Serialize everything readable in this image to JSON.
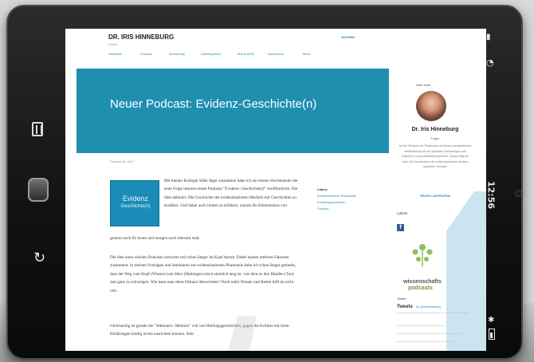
{
  "site": {
    "title": "DR. IRIS HINNEBURG",
    "subtitle": "Seiten",
    "search": "SUCHEN",
    "nav": [
      "Startseite",
      "Podcast",
      "Workshops",
      "Arbeitsproben",
      "Meine AGB",
      "Impressum",
      "Mehr…"
    ]
  },
  "post": {
    "title": "Neuer Podcast: Evidenz-Geschichte(n)",
    "date": "Februar 06, 2017",
    "thumbnail_line1": "Evidenz",
    "thumbnail_line2": "Geschichte(n)",
    "paragraph1a": "Mit meiner Kollegin Silke Jäger zusammen habe ich am letzten Wochenende die erste Folge unseres neuen Podcasts \"Evidenz- Geschichte(n)\" veröffentlicht. Die Idee dahinter: Die Geschichte der evidenzbasierten Medizin mit Geschichten zu erzählen. Und dabei auch immer zu erklären, warum die Erkenntnisse von",
    "paragraph1b": "gestern auch für heute und morgen noch relevant sind.",
    "paragraph2": "Die Idee eines solchen Podcasts schwirrte mir schon länger im Kopf herum. Dabei kamen mehrere Faktoren zusammen: In meinen Vorträgen und Seminaren zur evidenzbasierten Pharmazie habe ich schon länger gemerkt, dass der Weg vom Kopf (Wissen) zum Herz (Haltungen) doch ziemlich lang ist, von dem zu den Händen (Tun) mal ganz zu schweigen. Wie kann man diese Distanz überwinden? Noch mehr Wissen und Reden hilft da nicht viel.",
    "paragraph3": "Gleichzeitig ist gerade die \"Alternativ- Medizin\" voll von Heilungsgeschichten, gegen die Kritiker mit ihren Erklärungen häufig nichts ausrichten können. Sehr"
  },
  "labels": {
    "heading": "Labels",
    "items": [
      "Evidenzbasierte Pharmazie",
      "Evidenzgeschichten",
      "Podcast"
    ]
  },
  "sidebar": {
    "about_heading": "Über mich",
    "author": "Dr. Iris Hinneburg",
    "follow": "Folgen",
    "bio": "Ich bin Studium der Pharmazie und einer journalistischen Weiterbildung bin ich qualitativ hochwertigen und kritischen Gesundheitsinformationen. Darauf folgt ich mich mit Grundsätzen der evidenzbasierten Medizin angeführt. Kontakt:",
    "profile_link": "PROFIL AUFRUFEN",
    "labels_widget": "Labels",
    "facebook": "f",
    "logo_line1": "wissenschafts",
    "logo_line2": "podcasts",
    "twitter_heading": "Twitter",
    "tweets": "Tweets",
    "tweets_by": "by @irishinneburg"
  },
  "device": {
    "clock": "12:56"
  }
}
